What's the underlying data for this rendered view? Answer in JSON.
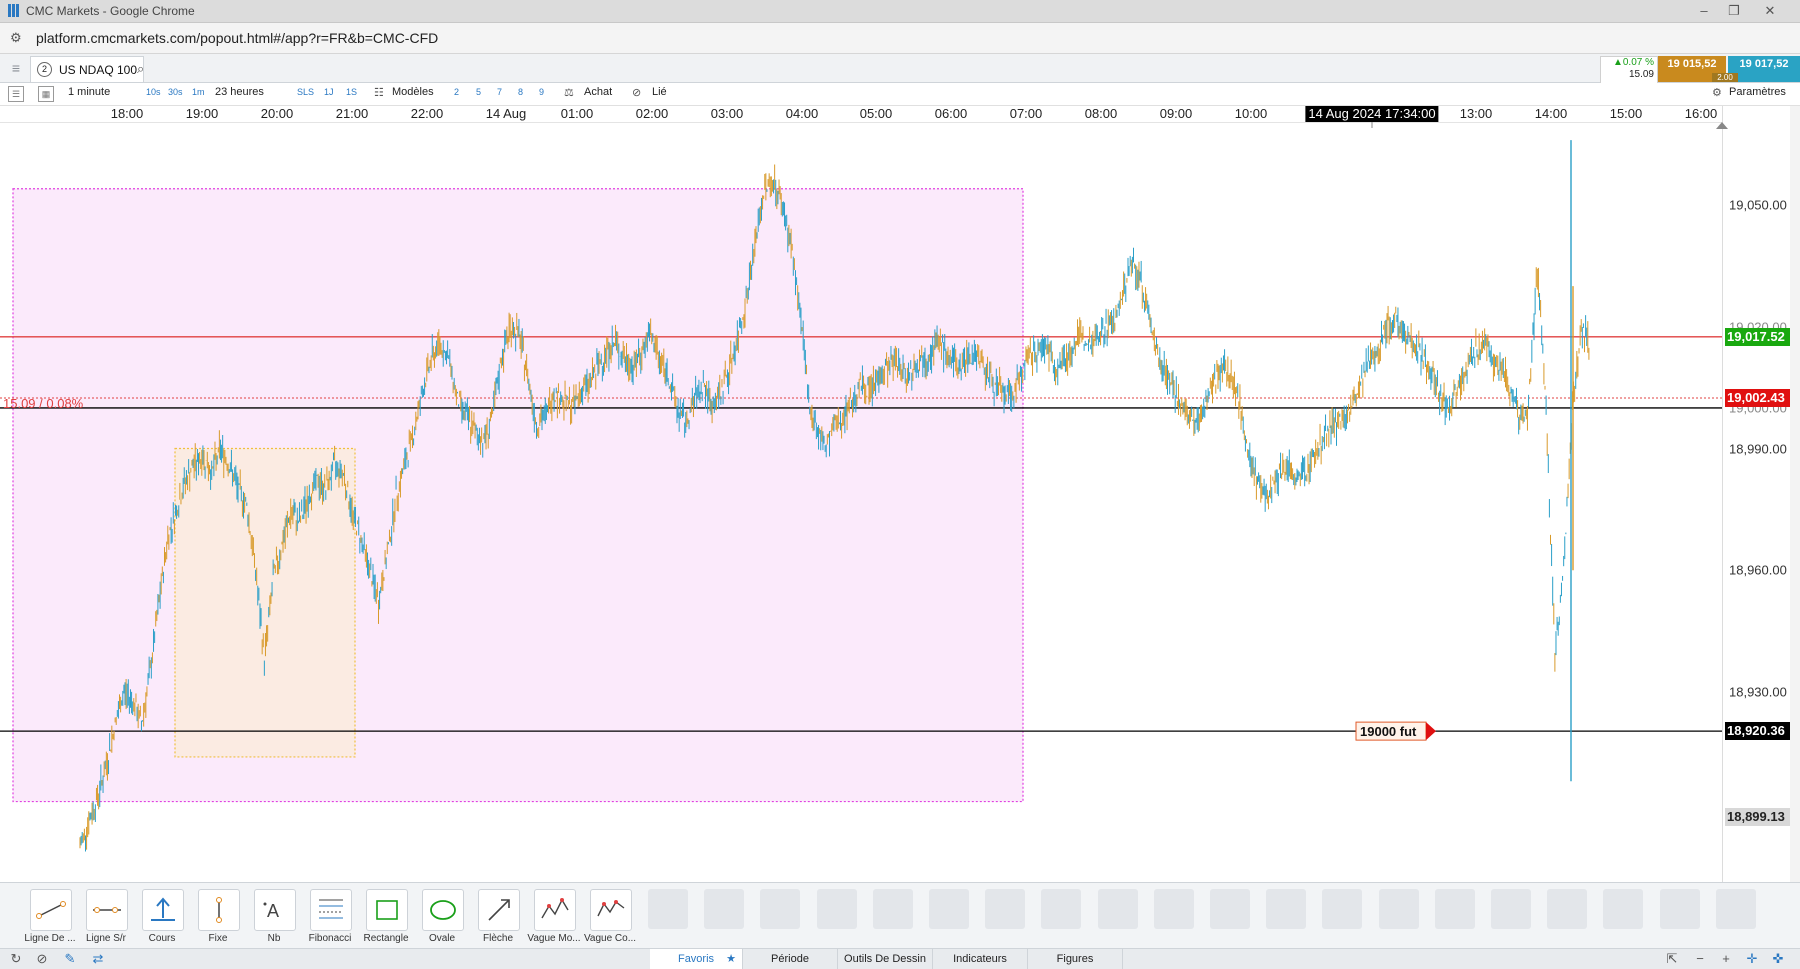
{
  "window": {
    "title": "CMC Markets - Google Chrome",
    "url": "platform.cmcmarkets.com/popout.html#/app?r=FR&b=CMC-CFD"
  },
  "instrument": {
    "tab_number": "2",
    "name": "US NDAQ 100",
    "change_pct": "▲0.07 %",
    "change_pts": "15.09",
    "sell_price": "19 015,52",
    "buy_price": "19 017,52",
    "spread": "2.00",
    "colors": {
      "sell": "#c98a1e",
      "buy": "#2aa3c4",
      "up": "#1aa01a"
    }
  },
  "toolbar": {
    "interval": "1 minute",
    "quick_intervals": [
      "10s",
      "30s",
      "1m"
    ],
    "range": "23 heures",
    "quick_ranges": [
      "SLS",
      "1J",
      "1S"
    ],
    "templates_label": "Modèles",
    "template_numbers": [
      "2",
      "5",
      "7",
      "8",
      "9"
    ],
    "buy_label": "Achat",
    "linked_label": "Lié",
    "settings_label": "Paramètres"
  },
  "time_axis": {
    "labels": [
      "18:00",
      "19:00",
      "20:00",
      "21:00",
      "22:00",
      "14 Aug",
      "01:00",
      "02:00",
      "03:00",
      "04:00",
      "05:00",
      "06:00",
      "07:00",
      "08:00",
      "09:00",
      "10:00",
      "13:00",
      "14:00",
      "15:00",
      "16:00"
    ],
    "crosshair_time": "14 Aug 2024 17:34:00"
  },
  "price_axis": {
    "labels": [
      "19,050.00",
      "18,990.00",
      "18,960.00",
      "18,930.00"
    ],
    "current_price": "19,017.52",
    "reference_price": "19,002.43",
    "hidden_labels": [
      "19,020.00",
      "19,000.00"
    ],
    "line_price": "18,920.36",
    "low_marker": "18,899.13",
    "colors": {
      "current": "#19a80f",
      "reference": "#e01010",
      "line": "#000000",
      "low": "#d8d8d8"
    }
  },
  "chart_data": {
    "type": "line",
    "series": [
      {
        "values": [
          18892,
          18898,
          18904,
          18912,
          18922,
          18930,
          18928,
          18922,
          18935,
          18952,
          18968,
          18975,
          18982,
          18986,
          18988,
          18984,
          18990,
          18986,
          18980,
          18976,
          18960,
          18938,
          18958,
          18966,
          18974,
          18972,
          18978,
          18982,
          18980,
          18986,
          18984,
          18974,
          18968,
          18960,
          18952,
          18964,
          18978,
          18986,
          18994,
          19004,
          19012,
          19016,
          19012,
          19002,
          18998,
          18994,
          18992,
          18998,
          19012,
          19020,
          19018,
          19008,
          18996,
          18998,
          19004,
          19002,
          19000,
          19004,
          19006,
          19010,
          19014,
          19016,
          19012,
          19010,
          19014,
          19018,
          19012,
          19008,
          19000,
          18996,
          19002,
          19006,
          19000,
          19004,
          19010,
          19018,
          19028,
          19042,
          19054,
          19056,
          19050,
          19040,
          19024,
          19002,
          18994,
          18990,
          18996,
          18998,
          19002,
          19006,
          19004,
          19008,
          19010,
          19012,
          19008,
          19010,
          19012,
          19014,
          19016,
          19012,
          19010,
          19012,
          19014,
          19010,
          19006,
          19004,
          19002,
          19008,
          19012,
          19014,
          19016,
          19010,
          19012,
          19014,
          19018,
          19016,
          19018,
          19020,
          19022,
          19030,
          19036,
          19030,
          19020,
          19012,
          19008,
          19002,
          18998,
          18996,
          19000,
          19006,
          19010,
          19008,
          19002,
          18990,
          18982,
          18978,
          18982,
          18986,
          18984,
          18982,
          18986,
          18990,
          18994,
          18996,
          18998,
          19000,
          19006,
          19012,
          19016,
          19020,
          19022,
          19018,
          19016,
          19012,
          19008,
          19002,
          19000,
          19006,
          19010,
          19014,
          19016,
          19012,
          19010,
          19004,
          18998,
          19000,
          19034,
          19000,
          18940,
          18960,
          19000,
          19020,
          19016
        ]
      }
    ],
    "rectangles": [
      {
        "label": "outer",
        "x_from": "17:55",
        "x_to": "07:00",
        "y_from": 18903,
        "y_to": 19054,
        "color": "#e040e0"
      },
      {
        "label": "inner",
        "x_from": "19:40",
        "x_to": "20:40",
        "y_from": 18914,
        "y_to": 18990,
        "color": "#f0c040"
      }
    ],
    "horizontal_lines": [
      {
        "price": 19017.52,
        "color": "#e04040"
      },
      {
        "price": 19002.43,
        "color": "#e04040",
        "dotted": true
      },
      {
        "price": 19000.0,
        "color": "#000000"
      },
      {
        "price": 18920.36,
        "color": "#000000"
      }
    ],
    "annotations": {
      "pct_label": "15.09 / 0.08%",
      "alert_label": "19000 fut"
    },
    "ylim": [
      18885,
      19070
    ]
  },
  "draw_tools": [
    {
      "label": "Ligne De ...",
      "icon": "line-icon"
    },
    {
      "label": "Ligne S/r",
      "icon": "support-line-icon"
    },
    {
      "label": "Cours",
      "icon": "price-line-icon"
    },
    {
      "label": "Fixe",
      "icon": "fixed-line-icon"
    },
    {
      "label": "Nb",
      "icon": "text-icon"
    },
    {
      "label": "Fibonacci",
      "icon": "fibonacci-icon"
    },
    {
      "label": "Rectangle",
      "icon": "rectangle-icon"
    },
    {
      "label": "Ovale",
      "icon": "oval-icon"
    },
    {
      "label": "Flèche",
      "icon": "arrow-icon"
    },
    {
      "label": "Vague Mo...",
      "icon": "wave-icon"
    },
    {
      "label": "Vague Co...",
      "icon": "wave-corrective-icon"
    }
  ],
  "bottom_tabs": [
    {
      "label": "Favoris",
      "active": true
    },
    {
      "label": "Période"
    },
    {
      "label": "Outils De Dessin"
    },
    {
      "label": "Indicateurs"
    },
    {
      "label": "Figures"
    }
  ]
}
